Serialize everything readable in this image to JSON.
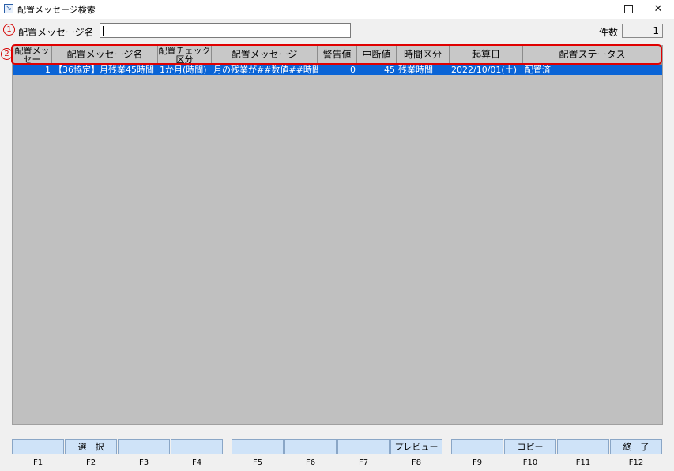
{
  "window": {
    "title": "配置メッセージ検索",
    "minimize": "—",
    "close": "✕"
  },
  "markers": {
    "one": "1",
    "two": "2"
  },
  "search": {
    "label": "配置メッセージ名",
    "value": ""
  },
  "count": {
    "label": "件数",
    "value": "1"
  },
  "table": {
    "headers": [
      "配置メッセー",
      "配置メッセージ名",
      "配置チェック区分",
      "配置メッセージ",
      "警告値",
      "中断値",
      "時間区分",
      "起算日",
      "配置ステータス"
    ],
    "rows": [
      [
        "1",
        "【36協定】月残業45時間",
        "1か月(時間)",
        "月の残業が##数値##時間",
        "0",
        "45",
        "残業時間",
        "2022/10/01(土)",
        "配置済"
      ]
    ]
  },
  "fkeys": [
    {
      "key": "F1",
      "label": ""
    },
    {
      "key": "F2",
      "label": "選　択"
    },
    {
      "key": "F3",
      "label": ""
    },
    {
      "key": "F4",
      "label": ""
    },
    {
      "key": "F5",
      "label": ""
    },
    {
      "key": "F6",
      "label": ""
    },
    {
      "key": "F7",
      "label": ""
    },
    {
      "key": "F8",
      "label": "プレビュー"
    },
    {
      "key": "F9",
      "label": ""
    },
    {
      "key": "F10",
      "label": "コピー"
    },
    {
      "key": "F11",
      "label": ""
    },
    {
      "key": "F12",
      "label": "終　了"
    }
  ],
  "colors": {
    "selection": "#0a64d6",
    "annotation": "#e00000",
    "fkey_bg": "#cfe3f8"
  }
}
